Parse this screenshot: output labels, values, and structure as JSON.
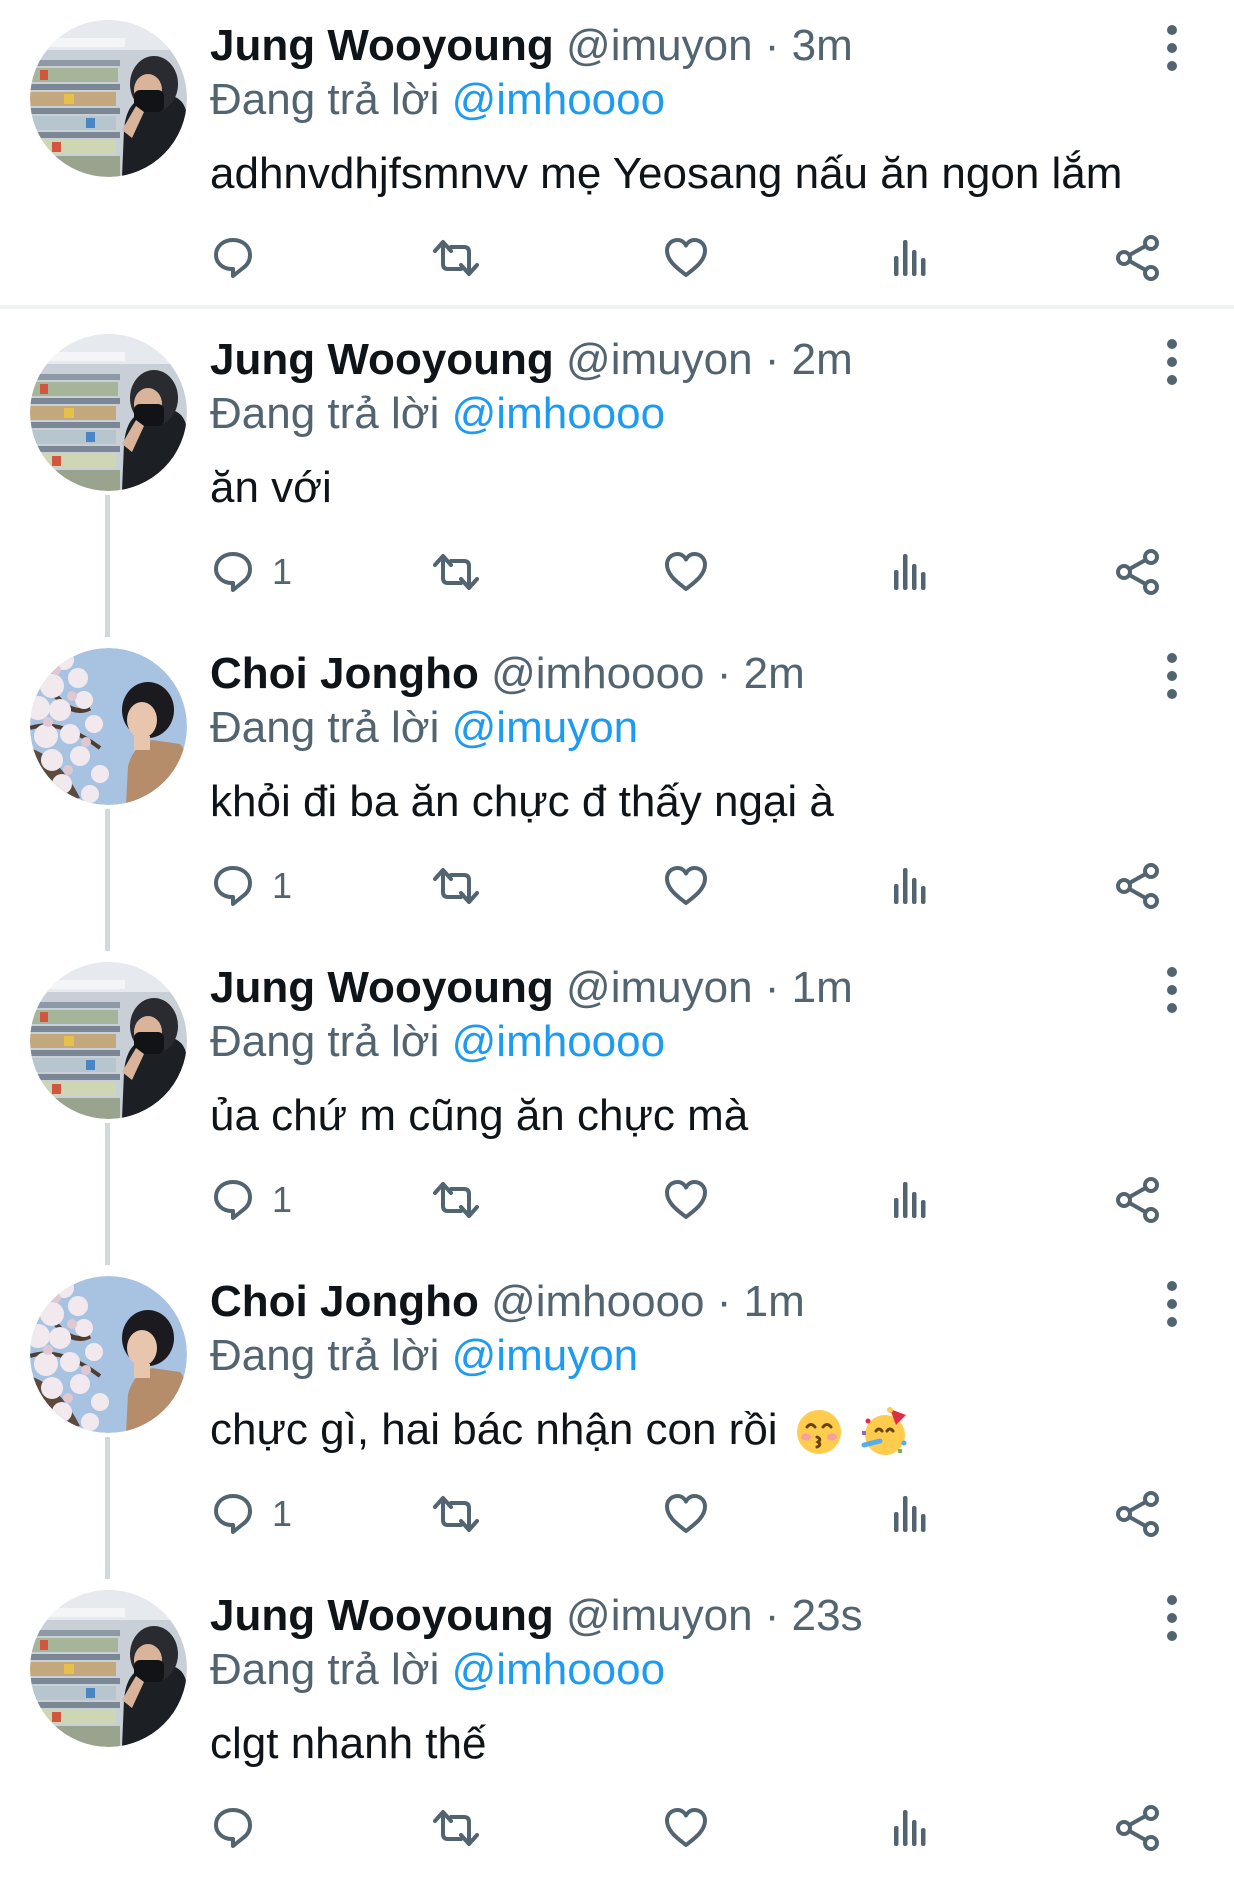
{
  "colors": {
    "text_primary": "#0f1419",
    "text_secondary": "#536471",
    "mention": "#1d9bf0",
    "separator": "#eff3f4",
    "thread_line": "#cfd9de"
  },
  "replying_prefix": "Đang trả lời",
  "icons": {
    "reply": "reply-icon",
    "retweet": "retweet-icon",
    "like": "heart-icon",
    "views": "views-icon",
    "share": "share-icon",
    "more": "more-options-icon"
  },
  "tweets": [
    {
      "name": "Jung Wooyoung",
      "handle": "@imuyon",
      "dot": "·",
      "time": "3m",
      "replying_to": "@imhoooo",
      "text": "adhnvdhjfsmnvv mẹ Yeosang nấu ăn ngon lắm",
      "reply_count": "",
      "avatar": "store-aisle-photo"
    },
    {
      "name": "Jung Wooyoung",
      "handle": "@imuyon",
      "dot": "·",
      "time": "2m",
      "replying_to": "@imhoooo",
      "text": "ăn với",
      "reply_count": "1",
      "avatar": "store-aisle-photo"
    },
    {
      "name": "Choi Jongho",
      "handle": "@imhoooo",
      "dot": "·",
      "time": "2m",
      "replying_to": "@imuyon",
      "text": "khỏi đi ba ăn chực đ thấy ngại à",
      "reply_count": "1",
      "avatar": "cherry-blossom-photo"
    },
    {
      "name": "Jung Wooyoung",
      "handle": "@imuyon",
      "dot": "·",
      "time": "1m",
      "replying_to": "@imhoooo",
      "text": "ủa chứ m cũng ăn chực mà",
      "reply_count": "1",
      "avatar": "store-aisle-photo"
    },
    {
      "name": "Choi Jongho",
      "handle": "@imhoooo",
      "dot": "·",
      "time": "1m",
      "replying_to": "@imuyon",
      "text": "chực gì, hai bác nhận con rồi",
      "emojis": [
        "kissing-face-emoji",
        "partying-face-emoji"
      ],
      "reply_count": "1",
      "avatar": "cherry-blossom-photo"
    },
    {
      "name": "Jung Wooyoung",
      "handle": "@imuyon",
      "dot": "·",
      "time": "23s",
      "replying_to": "@imhoooo",
      "text": "clgt nhanh thế",
      "reply_count": "",
      "avatar": "store-aisle-photo"
    }
  ]
}
